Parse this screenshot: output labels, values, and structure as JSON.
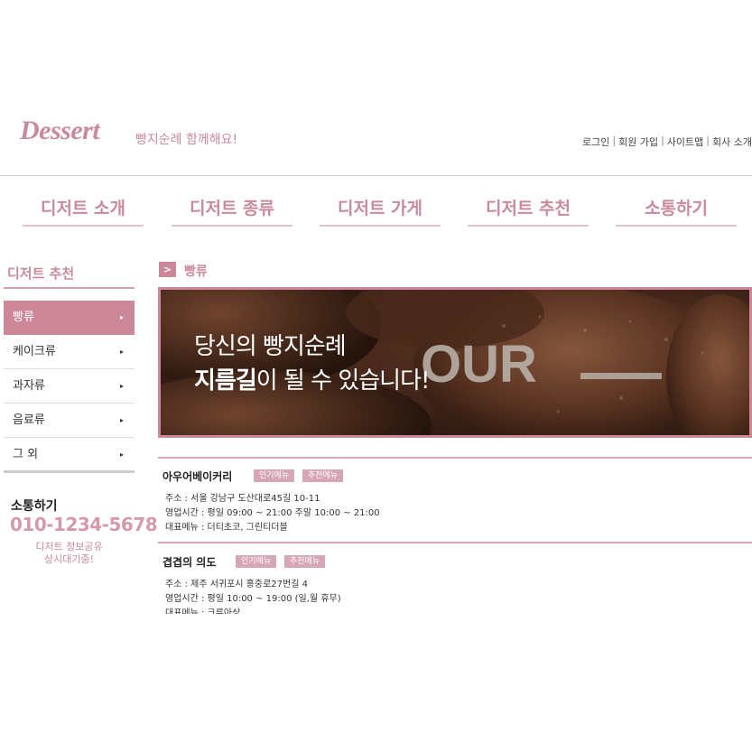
{
  "header": {
    "logo": "Dessert",
    "tagline": "빵지순례 함께해요!",
    "util_links": [
      "로그인",
      "회원 가입",
      "사이트맵",
      "회사 소개"
    ]
  },
  "gnb": [
    "디저트 소개",
    "디저트 종류",
    "디저트 가게",
    "디저트 추천",
    "소통하기"
  ],
  "sidebar": {
    "title": "디저트 추천",
    "items": [
      {
        "label": "빵류"
      },
      {
        "label": "케이크류"
      },
      {
        "label": "과자류"
      },
      {
        "label": "음료류"
      },
      {
        "label": "그 외"
      }
    ],
    "arrow_glyph": "▸"
  },
  "contact": {
    "title": "소통하기",
    "phone": "010-1234-5678",
    "line1": "디저트 정보공유",
    "line2": "상시대기중!"
  },
  "breadcrumb": {
    "icon": ">",
    "label": "빵류"
  },
  "banner": {
    "line1": "당신의 빵지순례",
    "line2_bold": "지름길",
    "line2_rest": "이 될 수 있습니다!",
    "bread_text": "OUR"
  },
  "stores": [
    {
      "name": "아우어베이커리",
      "tags": [
        "인기메뉴",
        "추천메뉴"
      ],
      "address": "주소 : 서울 강남구 도산대로45길 10-11",
      "hours": "영업시간 : 평일 09:00 ~ 21:00 주말 10:00 ~ 21:00",
      "menu": "대표메뉴 : 더티초코, 그린티더블"
    },
    {
      "name": "겹겹의 의도",
      "tags": [
        "인기메뉴",
        "추천메뉴"
      ],
      "address": "주소 : 제주 서귀포시 홍중로27번길 4",
      "hours": "영업시간 : 평일 10:00 ~ 19:00 (일,월 휴무)",
      "menu": "대표메뉴 : 크루아상"
    }
  ],
  "colors": {
    "accent": "#cc8899",
    "accent_text": "#c98a9b",
    "tag_bg": "#d7a6b4"
  }
}
